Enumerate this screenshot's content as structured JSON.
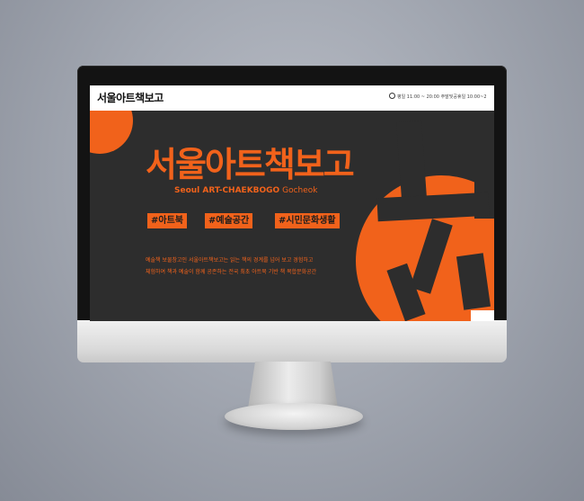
{
  "site": {
    "logo": "서울아트책보고",
    "hours": "평일 11:00 ~ 20:00 주말및공휴일 10:00~2"
  },
  "hero": {
    "title": "서울아트책보고",
    "title_small": "아트",
    "subtitle_main": "Seoul ART-CHAEKBOGO",
    "subtitle_sub": "Gocheok",
    "tags": [
      "#아트북",
      "#예술공간",
      "#시민문화생활"
    ],
    "description": [
      "예술책 보물창고인 서울아트책보고는 읽는 책의 경계를 넘어 보고 경험하고",
      "체험하여 책과 예술이 함께 공존하는 전국 최초 아트북 기반 책 복합문화공간"
    ]
  },
  "colors": {
    "accent": "#f1621b",
    "dark_bg": "#2d2d2d",
    "header_bg": "#ffffff"
  }
}
